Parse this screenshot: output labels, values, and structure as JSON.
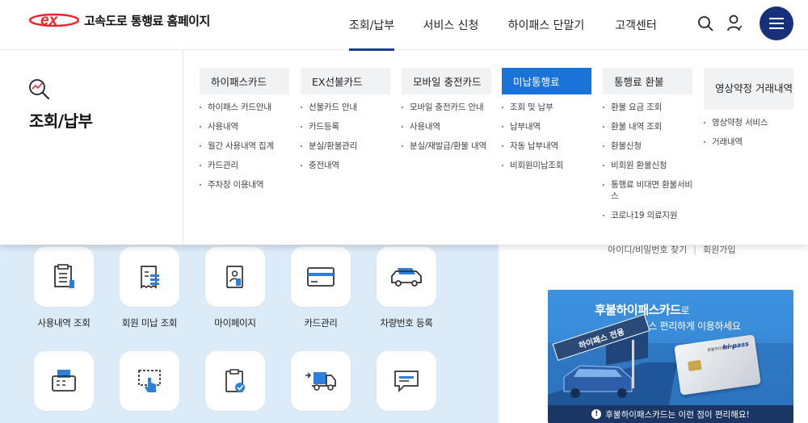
{
  "header": {
    "logo_mark": "ex",
    "site_title": "고속도로 통행료 홈페이지",
    "nav": [
      {
        "label": "조회/납부",
        "active": true
      },
      {
        "label": "서비스 신청",
        "active": false
      },
      {
        "label": "하이패스 단말기",
        "active": false
      },
      {
        "label": "고객센터",
        "active": false
      }
    ],
    "icons": [
      "search-icon",
      "user-icon",
      "hamburger-menu-icon"
    ]
  },
  "mega": {
    "title": "조회/납부",
    "columns": [
      {
        "head": "하이패스카드",
        "active": false,
        "items": [
          "하이패스 카드안내",
          "사용내역",
          "월간 사용내역 집계",
          "카드관리",
          "주차장 이용내역"
        ]
      },
      {
        "head": "EX선불카드",
        "active": false,
        "items": [
          "선불카드 안내",
          "카드등록",
          "분실/환불관리",
          "충전내역"
        ]
      },
      {
        "head": "모바일 충전카드",
        "active": false,
        "items": [
          "모바일 충전카드 안내",
          "사용내역",
          "분실/재발급/환불 내역"
        ]
      },
      {
        "head": "미납통행료",
        "active": true,
        "items": [
          "조회 및 납부",
          "납부내역",
          "자동 납부내역",
          "비회원미납조회"
        ]
      },
      {
        "head": "통행료 환불",
        "active": false,
        "items": [
          "환불 요금 조회",
          "환불 내역 조회",
          "환불신청",
          "비회원 환불신청",
          "통행료 비대면 환불서비스",
          "코로나19 의료지원"
        ]
      },
      {
        "head": "영상약정 거래내역",
        "active": false,
        "items": [
          "영상약정 서비스",
          "거래내역"
        ]
      }
    ]
  },
  "quick_menu": [
    {
      "label": "사용내역 조회",
      "icon": "document-list-icon"
    },
    {
      "label": "회원 미납 조회",
      "icon": "receipt-icon"
    },
    {
      "label": "마이페이지",
      "icon": "profile-card-icon"
    },
    {
      "label": "카드관리",
      "icon": "credit-card-icon"
    },
    {
      "label": "차량번호 등록",
      "icon": "car-icon"
    },
    {
      "label": "",
      "icon": "fax-machine-icon"
    },
    {
      "label": "",
      "icon": "touch-screen-icon"
    },
    {
      "label": "",
      "icon": "clipboard-check-icon"
    },
    {
      "label": "",
      "icon": "truck-icon"
    },
    {
      "label": "",
      "icon": "chat-bubble-icon"
    }
  ],
  "login_links": {
    "find": "아이디/비밀번호 찾기",
    "join": "회원가입"
  },
  "banner": {
    "title_main": "후불하이패스카드",
    "title_suffix": "로",
    "subtitle": "하이패스 편리하게 이용하세요",
    "sign_text": "하이패스 전용",
    "card_brand": "hi-pass",
    "card_name": "후불하이패스카드",
    "bottom_text": "후불하이패스카드는 이런 점이 편리해요!"
  },
  "colors": {
    "brand_red": "#e8262b",
    "navy": "#16307a",
    "active_blue": "#1a73d9"
  }
}
